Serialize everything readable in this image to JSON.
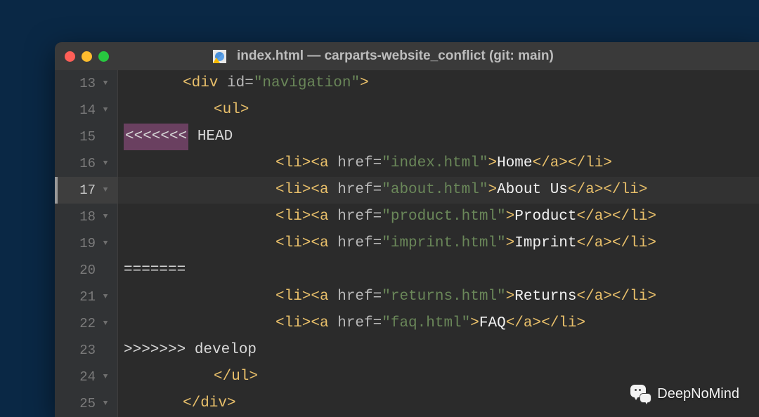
{
  "window": {
    "title": "index.html — carparts-website_conflict (git: main)"
  },
  "editor": {
    "current_line_index": 4,
    "lines": [
      {
        "num": 13,
        "fold": true,
        "indent": 1,
        "segs": [
          [
            "tag",
            "<div "
          ],
          [
            "attr",
            "id="
          ],
          [
            "str",
            "\"navigation\""
          ],
          [
            "tag",
            ">"
          ]
        ]
      },
      {
        "num": 14,
        "fold": true,
        "indent": 2,
        "segs": [
          [
            "tag",
            "<ul>"
          ]
        ]
      },
      {
        "num": 15,
        "fold": false,
        "indent": 0,
        "segs": [
          [
            "conflict-hl",
            "<<<<<<<"
          ],
          [
            "conflict",
            " HEAD"
          ]
        ]
      },
      {
        "num": 16,
        "fold": true,
        "indent": 3,
        "segs": [
          [
            "tag",
            "<li><a "
          ],
          [
            "attr",
            "href="
          ],
          [
            "str",
            "\"index.html\""
          ],
          [
            "tag",
            ">"
          ],
          [
            "txt",
            "Home"
          ],
          [
            "tag",
            "</a></li>"
          ]
        ]
      },
      {
        "num": 17,
        "fold": true,
        "indent": 3,
        "segs": [
          [
            "tag",
            "<li><a "
          ],
          [
            "attr",
            "href="
          ],
          [
            "str",
            "\"about.html\""
          ],
          [
            "tag",
            ">"
          ],
          [
            "txt",
            "About Us"
          ],
          [
            "tag",
            "</a></li>"
          ]
        ]
      },
      {
        "num": 18,
        "fold": true,
        "indent": 3,
        "segs": [
          [
            "tag",
            "<li><a "
          ],
          [
            "attr",
            "href="
          ],
          [
            "str",
            "\"product.html\""
          ],
          [
            "tag",
            ">"
          ],
          [
            "txt",
            "Product"
          ],
          [
            "tag",
            "</a></li>"
          ]
        ]
      },
      {
        "num": 19,
        "fold": true,
        "indent": 3,
        "segs": [
          [
            "tag",
            "<li><a "
          ],
          [
            "attr",
            "href="
          ],
          [
            "str",
            "\"imprint.html\""
          ],
          [
            "tag",
            ">"
          ],
          [
            "txt",
            "Imprint"
          ],
          [
            "tag",
            "</a></li>"
          ]
        ]
      },
      {
        "num": 20,
        "fold": false,
        "indent": 0,
        "segs": [
          [
            "conflict",
            "======="
          ]
        ]
      },
      {
        "num": 21,
        "fold": true,
        "indent": 3,
        "segs": [
          [
            "tag",
            "<li><a "
          ],
          [
            "attr",
            "href="
          ],
          [
            "str",
            "\"returns.html\""
          ],
          [
            "tag",
            ">"
          ],
          [
            "txt",
            "Returns"
          ],
          [
            "tag",
            "</a></li>"
          ]
        ]
      },
      {
        "num": 22,
        "fold": true,
        "indent": 3,
        "segs": [
          [
            "tag",
            "<li><a "
          ],
          [
            "attr",
            "href="
          ],
          [
            "str",
            "\"faq.html\""
          ],
          [
            "tag",
            ">"
          ],
          [
            "txt",
            "FAQ"
          ],
          [
            "tag",
            "</a></li>"
          ]
        ]
      },
      {
        "num": 23,
        "fold": false,
        "indent": 0,
        "segs": [
          [
            "conflict",
            ">>>>>>> develop"
          ]
        ]
      },
      {
        "num": 24,
        "fold": true,
        "indent": 2,
        "segs": [
          [
            "tag",
            "</ul>"
          ]
        ]
      },
      {
        "num": 25,
        "fold": true,
        "indent": 1,
        "segs": [
          [
            "tag",
            "</div>"
          ]
        ]
      }
    ]
  },
  "watermark": {
    "label": "DeepNoMind"
  }
}
